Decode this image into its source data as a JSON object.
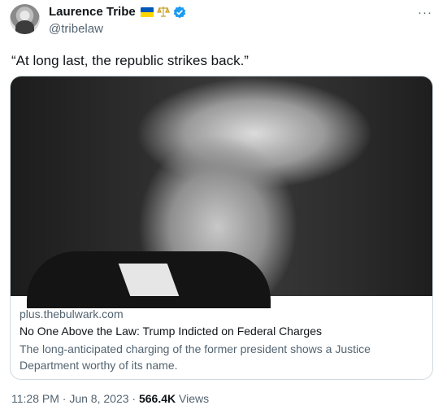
{
  "author": {
    "name": "Laurence Tribe",
    "handle": "@tribelaw",
    "badges": [
      "ukraine-flag-icon",
      "scales-icon",
      "verified-icon"
    ]
  },
  "tweet": {
    "text": "“At long last, the republic strikes back.”"
  },
  "card": {
    "domain": "plus.thebulwark.com",
    "title": "No One Above the Law: Trump Indicted on Federal Charges",
    "description": "The long-anticipated charging of the former president shows a Justice Department worthy of its name."
  },
  "meta": {
    "time": "11:28 PM",
    "separator": "·",
    "date": "Jun 8, 2023",
    "views_count": "566.4K",
    "views_label": "Views"
  },
  "colors": {
    "verified": "#1d9bf0",
    "secondary_text": "#536471",
    "card_border": "#cfd9de"
  }
}
